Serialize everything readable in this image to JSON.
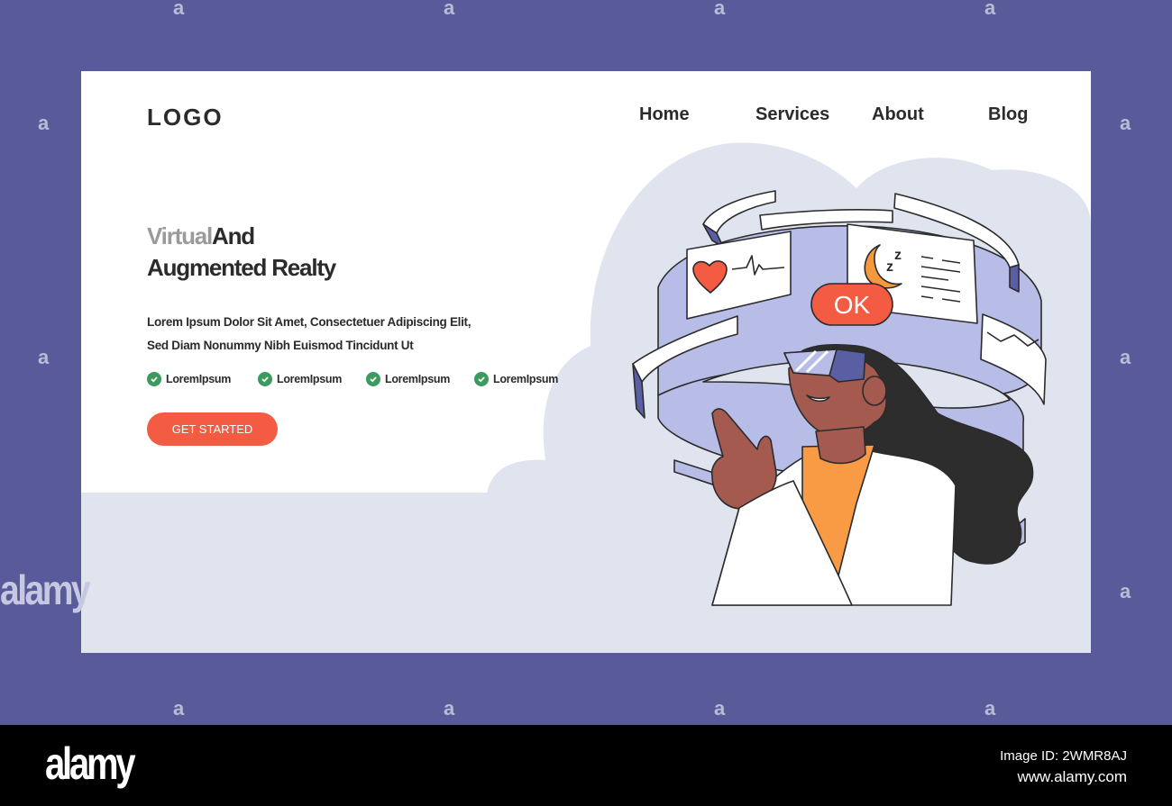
{
  "header": {
    "logo": "LOGO",
    "nav": [
      "Home",
      "Services",
      "About",
      "Blog"
    ]
  },
  "hero": {
    "title_line1_faded": "Virtual",
    "title_line1_rest": "And",
    "title_line2": "Augmented Realty",
    "description": "Lorem Ipsum Dolor Sit Amet, Consectetuer Adipiscing Elit, Sed Diam Nonummy Nibh Euismod Tincidunt Ut",
    "features": [
      "LoremIpsum",
      "LoremIpsum",
      "LoremIpsum",
      "LoremIpsum"
    ],
    "cta_label": "GET STARTED"
  },
  "illustration": {
    "ok_badge": "OK",
    "sleep_glyph": "zZ"
  },
  "colors": {
    "outer_bg": "#585a99",
    "accent": "#f45b43",
    "check": "#3a9b5c",
    "ring": "#b8bde8",
    "ring_dark": "#5a5ea3",
    "cloud": "#dfe4ee",
    "skin": "#a45a4e",
    "shirt": "#f99a45",
    "moon": "#f59a3c"
  },
  "watermark": {
    "side_mark": "a",
    "brand": "alamy",
    "image_id": "Image ID: 2WMR8AJ",
    "url": "www.alamy.com"
  }
}
